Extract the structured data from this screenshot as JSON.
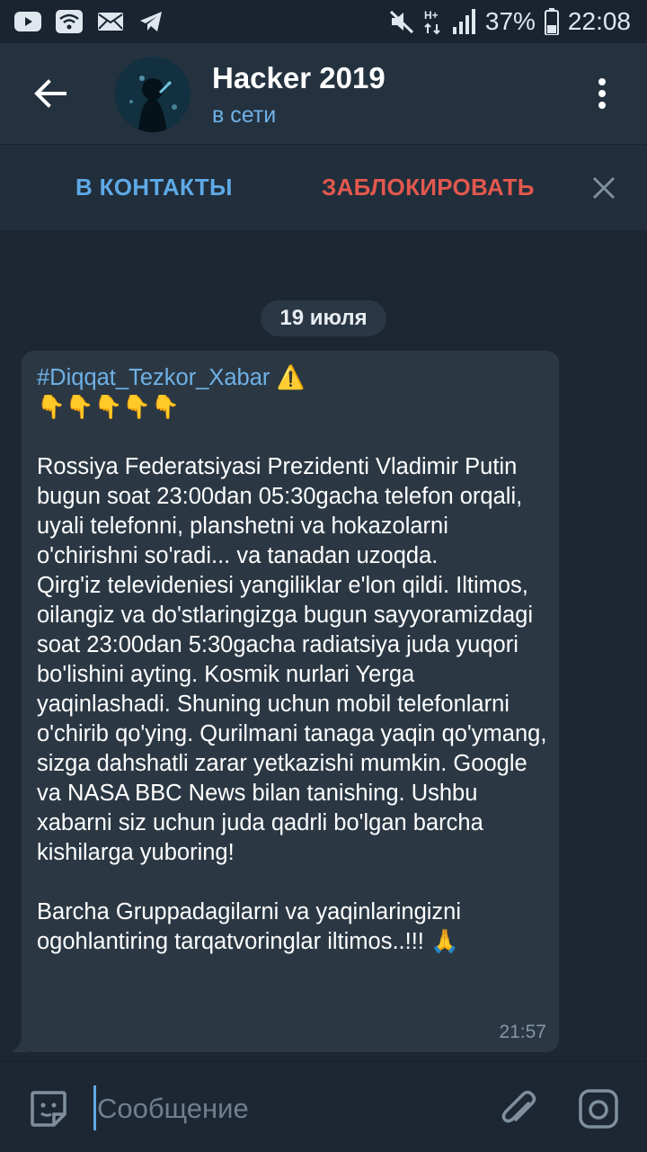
{
  "status_bar": {
    "left_icons": [
      "youtube-icon",
      "wifi-icon",
      "mail-icon",
      "telegram-icon"
    ],
    "right_icons": [
      "mute-icon",
      "signal-h-plus-icon",
      "signal-bars-icon",
      "battery-icon"
    ],
    "battery": "37%",
    "time": "22:08"
  },
  "header": {
    "title": "Hacker 2019",
    "subtitle": "в сети"
  },
  "action_bar": {
    "add_contact_label": "В КОНТАКТЫ",
    "block_label": "ЗАБЛОКИРОВАТЬ"
  },
  "chat": {
    "date": "19 июля",
    "message": {
      "hashtag": "#Diqqat_Tezkor_Xabar",
      "warning_emoji": "⚠️",
      "pointing_emojis": "👇👇👇👇👇",
      "body": "Rossiya Federatsiyasi Prezidenti Vladimir Putin bugun soat 23:00dan 05:30gacha telefon orqali, uyali telefonni, planshetni va hokazolarni o'chirishni so'radi... va tanadan uzoqda.\nQirg'iz televideniesi yangiliklar e'lon qildi. Iltimos, oilangiz va do'stlaringizga bugun sayyoramizdagi soat 23:00dan 5:30gacha radiatsiya juda yuqori bo'lishini ayting. Kosmik nurlari Yerga yaqinlashadi. Shuning uchun mobil telefonlarni o'chirib qo'ying. Qurilmani tanaga yaqin qo'ymang, sizga dahshatli zarar yetkazishi mumkin. Google va NASA BBC News bilan tanishing. Ushbu xabarni siz uchun juda qadrli bo'lgan barcha kishilarga yuboring!\n\nBarcha Gruppadagilarni va yaqinlaringizni ogohlantiring tarqatvoringlar iltimos..!!! 🙏",
      "time": "21:57"
    }
  },
  "input_bar": {
    "placeholder": "Сообщение",
    "value": ""
  },
  "colors": {
    "background": "#1d2733",
    "header": "#243240",
    "bubble": "#2b3844",
    "accent": "#5ea9e6",
    "danger": "#e2584e"
  }
}
